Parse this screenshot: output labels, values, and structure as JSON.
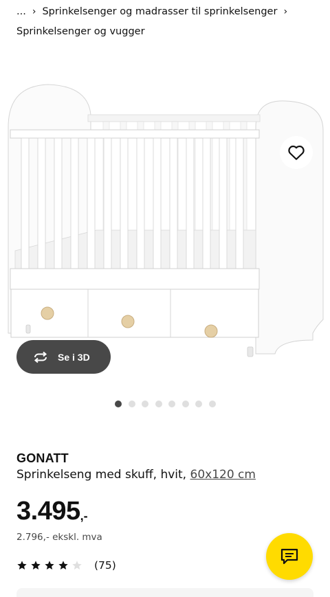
{
  "breadcrumb": {
    "ellipsis": "...",
    "items": [
      "Sprinkelsenger og madrasser til sprinkelsenger",
      "Sprinkelsenger og vugger"
    ]
  },
  "gallery": {
    "view_3d_label": "Se i 3D",
    "slide_count": 8,
    "active_slide": 1
  },
  "product": {
    "name": "GONATT",
    "description": "Sprinkelseng med skuff, hvit,",
    "size_link": "60x120 cm",
    "price": "3.495",
    "price_suffix": ",-",
    "price_ex_vat": "2.796,- ekskl. mva",
    "rating": 4,
    "rating_max": 5,
    "review_count": "(75)"
  },
  "colors": {
    "accent_yellow": "#ffdb00",
    "dark_button": "#484848",
    "text": "#111111"
  },
  "icons": {
    "favorite": "heart-icon",
    "view_3d": "rotate-icon",
    "chat": "chat-icon"
  }
}
